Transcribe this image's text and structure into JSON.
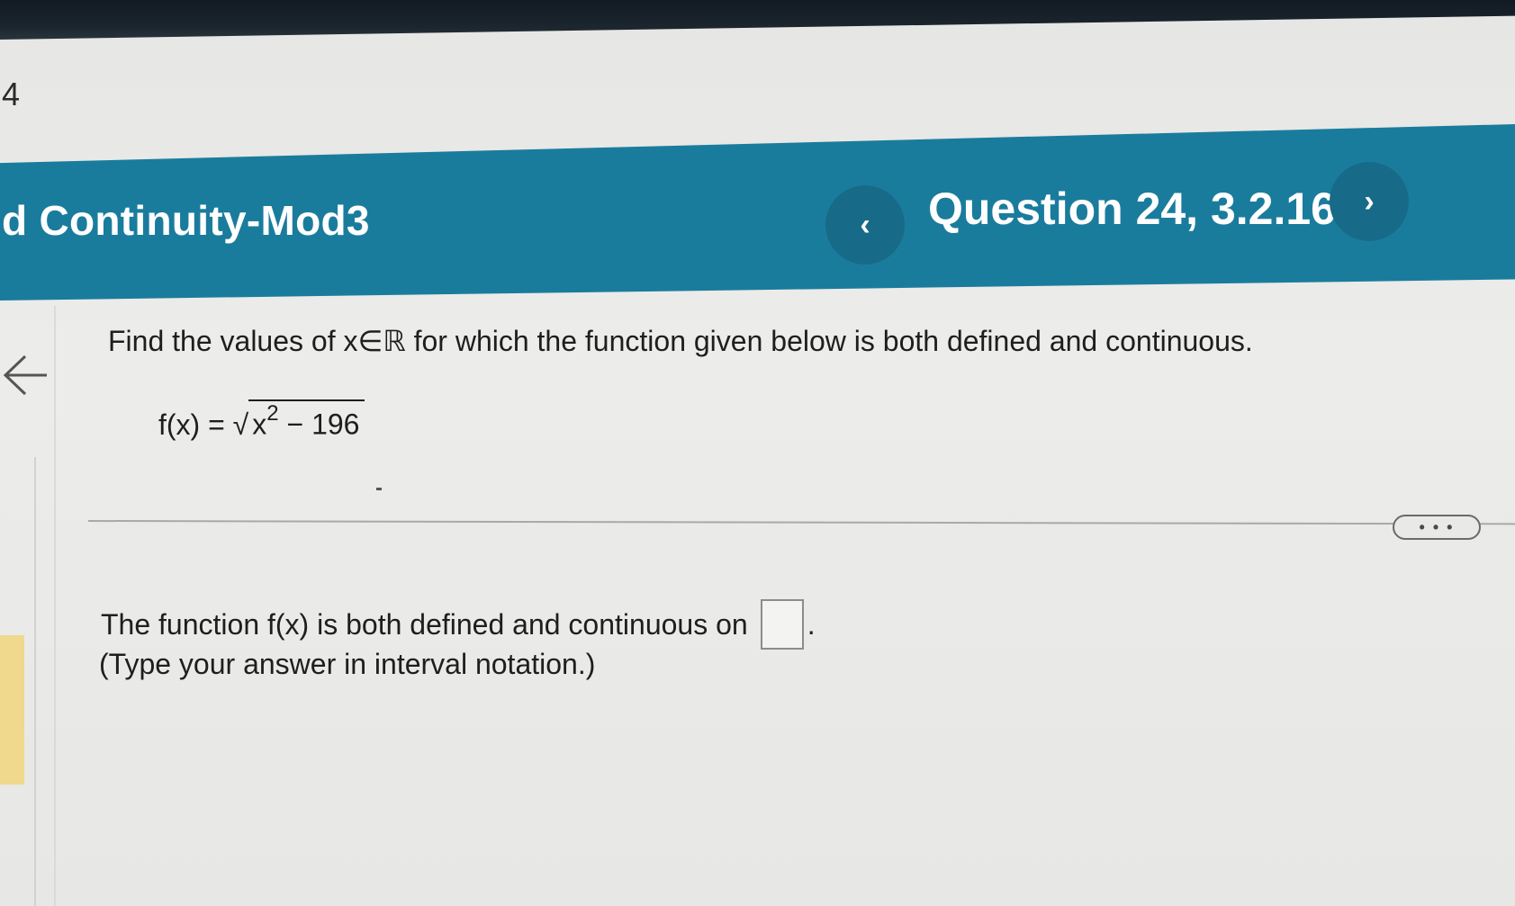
{
  "page_number": "4",
  "header": {
    "title": "d Continuity-Mod3",
    "question": "Question 24, 3.2.16",
    "prev_symbol": "‹",
    "next_symbol": "›"
  },
  "question": {
    "prompt": "Find the values of x∈ℝ for which the function given below is both defined and continuous.",
    "formula_lhs": "f(x) = √",
    "formula_base": "x",
    "formula_exponent": "2",
    "formula_rest": " − 196"
  },
  "more_button": "• • •",
  "answer": {
    "text": "The function f(x) is both defined and continuous on",
    "trailing": ".",
    "instruction": "(Type your answer in interval notation.)",
    "value": ""
  },
  "colors": {
    "header_bg": "#1a7c9d",
    "nav_button_bg": "#176b88",
    "side_tab": "#f0d88c"
  },
  "icons": {
    "back": "arrow-left-icon",
    "prev": "chevron-left-icon",
    "next": "chevron-right-icon",
    "more": "ellipsis-icon"
  }
}
